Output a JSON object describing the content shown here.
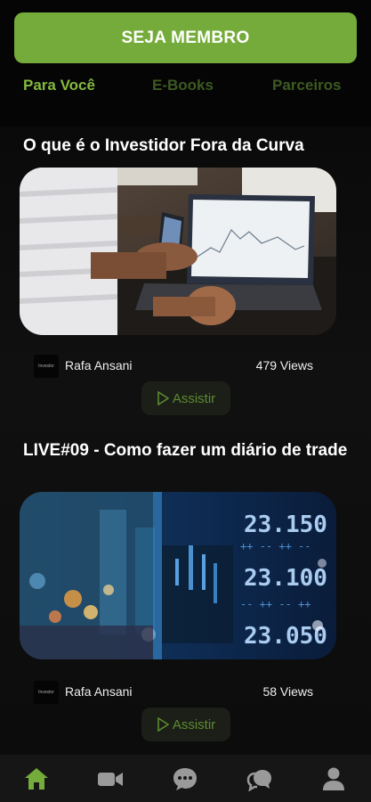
{
  "header": {
    "cta_label": "SEJA MEMBRO",
    "tabs": [
      {
        "label": "Para Você",
        "active": true
      },
      {
        "label": "E-Books",
        "active": false
      },
      {
        "label": "Parceiros",
        "active": false
      }
    ]
  },
  "feed": {
    "items": [
      {
        "title": "O que é o Investidor Fora da Curva",
        "thumbnail_icon": "laptop-chart-photo",
        "author": "Rafa Ansani",
        "avatar_text": "Investor",
        "views": "479 Views",
        "watch_label": "Assistir"
      },
      {
        "title": "LIVE#09 - Como fazer um diário de trade",
        "thumbnail_icon": "stock-ticker-photo",
        "author": "Rafa Ansani",
        "avatar_text": "Investor",
        "views": "58 Views",
        "watch_label": "Assistir"
      }
    ]
  },
  "navbar": {
    "items": [
      {
        "icon": "home-icon",
        "active": true
      },
      {
        "icon": "video-camera-icon",
        "active": false
      },
      {
        "icon": "chat-bubble-icon",
        "active": false
      },
      {
        "icon": "chat-bubbles-icon",
        "active": false
      },
      {
        "icon": "profile-icon",
        "active": false
      }
    ]
  },
  "colors": {
    "accent": "#75ab3a",
    "tab_active": "#84b83f",
    "tab_inactive": "#3d5a22",
    "background": "#000000",
    "navbar_bg": "#161616",
    "icon_inactive": "#9a9a9a"
  }
}
